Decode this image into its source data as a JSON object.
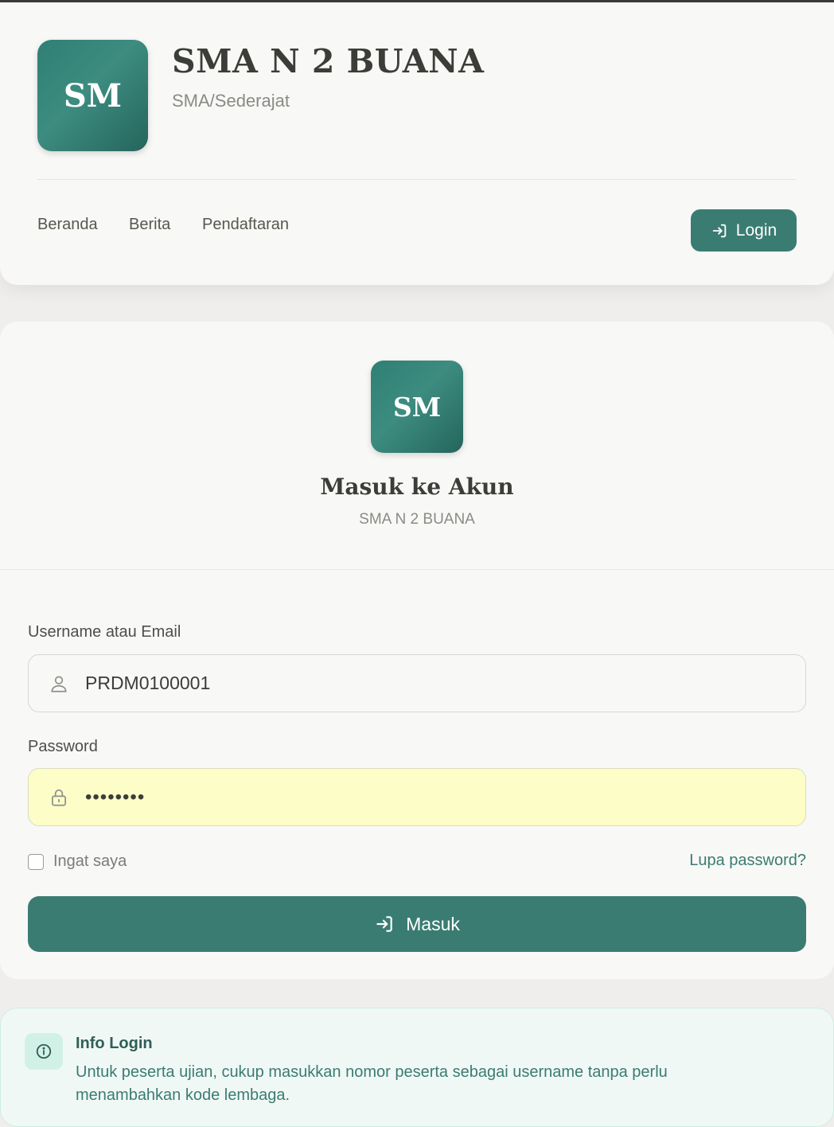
{
  "header": {
    "logo_text": "SM",
    "school_name": "SMA N 2 BUANA",
    "school_type": "SMA/Sederajat",
    "nav": [
      "Beranda",
      "Berita",
      "Pendaftaran"
    ],
    "login_label": "Login"
  },
  "login_card": {
    "logo_text": "SM",
    "title": "Masuk ke Akun",
    "subtitle": "SMA N 2 BUANA",
    "username_label": "Username atau Email",
    "username_value": "PRDM0100001",
    "password_label": "Password",
    "password_value": "••••••••",
    "remember_label": "Ingat saya",
    "forgot_label": "Lupa password?",
    "submit_label": "Masuk"
  },
  "info": {
    "title": "Info Login",
    "text": "Untuk peserta ujian, cukup masukkan nomor peserta sebagai username tanpa perlu menambahkan kode lembaga."
  },
  "colors": {
    "primary": "#3a7c72",
    "background": "#efeeec",
    "autofill": "#fcfdc7",
    "info_bg": "#f0f8f5"
  }
}
